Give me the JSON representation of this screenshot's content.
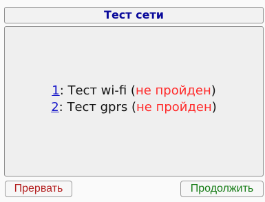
{
  "window": {
    "title": "Тест сети"
  },
  "tests": [
    {
      "index": "1",
      "label": ": Тест wi-fi (",
      "status": "не пройден",
      "suffix": ")"
    },
    {
      "index": "2",
      "label": ": Тест gprs (",
      "status": "не пройден",
      "suffix": ")"
    }
  ],
  "buttons": {
    "abort": "Прервать",
    "continue": "Продолжить"
  },
  "colors": {
    "title": "#0a0a9b",
    "index_link": "#1616c9",
    "fail_status": "#ff2a2a",
    "abort_button": "#b31f1f",
    "continue_button": "#167c16"
  }
}
